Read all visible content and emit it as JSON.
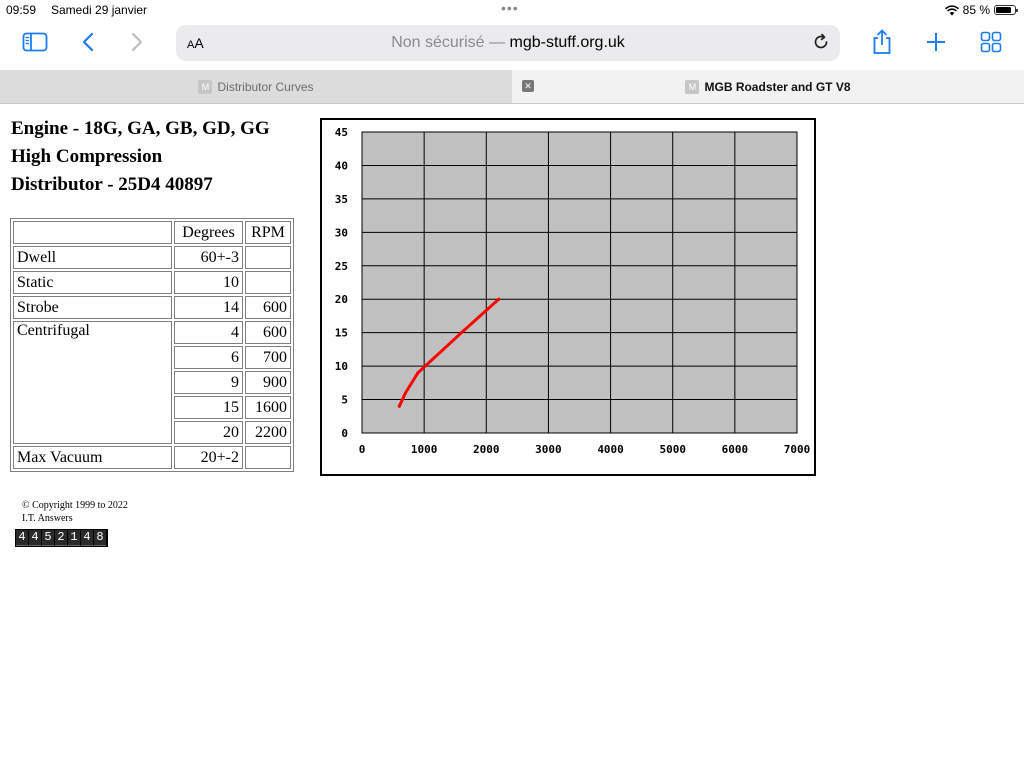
{
  "status_bar": {
    "time": "09:59",
    "date": "Samedi 29 janvier",
    "battery_text": "85 %",
    "battery_level": 0.85
  },
  "toolbar": {
    "aa_small": "A",
    "aa_big": "A",
    "url_insecure": "Non sécurisé —",
    "url_host": "mgb-stuff.org.uk"
  },
  "tabs": [
    {
      "favicon": "M",
      "title": "Distributor Curves"
    },
    {
      "favicon": "M",
      "title": "MGB Roadster and GT V8"
    }
  ],
  "page": {
    "heading": [
      "Engine - 18G, GA, GB, GD, GG",
      "High Compression",
      "Distributor - 25D4 40897"
    ],
    "table": {
      "headers": [
        "",
        "Degrees",
        "RPM"
      ],
      "dwell": {
        "label": "Dwell",
        "degrees": "60+-3",
        "rpm": ""
      },
      "static": {
        "label": "Static",
        "degrees": "10",
        "rpm": ""
      },
      "strobe": {
        "label": "Strobe",
        "degrees": "14",
        "rpm": "600"
      },
      "centrifugal": {
        "label": "Centrifugal",
        "rows": [
          {
            "degrees": "4",
            "rpm": "600"
          },
          {
            "degrees": "6",
            "rpm": "700"
          },
          {
            "degrees": "9",
            "rpm": "900"
          },
          {
            "degrees": "15",
            "rpm": "1600"
          },
          {
            "degrees": "20",
            "rpm": "2200"
          }
        ]
      },
      "max_vacuum": {
        "label": "Max Vacuum",
        "degrees": "20+-2",
        "rpm": ""
      }
    },
    "copyright": [
      "© Copyright 1999 to 2022",
      "I.T. Answers"
    ],
    "counter": "4452148"
  },
  "chart_data": {
    "type": "line",
    "title": "",
    "xlabel": "",
    "ylabel": "",
    "xlim": [
      0,
      7000
    ],
    "ylim": [
      0,
      45
    ],
    "x_ticks": [
      0,
      1000,
      2000,
      3000,
      4000,
      5000,
      6000,
      7000
    ],
    "y_ticks": [
      0,
      5,
      10,
      15,
      20,
      25,
      30,
      35,
      40,
      45
    ],
    "grid": true,
    "plot_background": "#c0c0c0",
    "series": [
      {
        "color": "#ff0000",
        "x": [
          600,
          700,
          900,
          1600,
          2200
        ],
        "y": [
          4,
          6,
          9,
          15,
          20
        ]
      }
    ]
  }
}
